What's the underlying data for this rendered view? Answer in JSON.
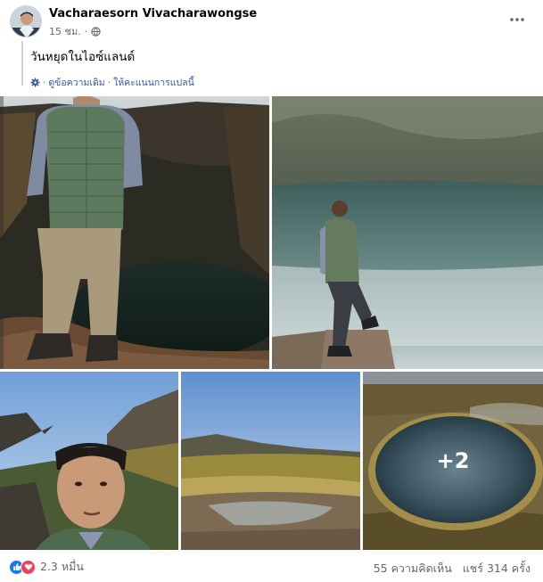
{
  "post": {
    "author": "Vacharaesorn Vivacharawongse",
    "time": "15 ชม.",
    "privacy_icon": "globe-icon",
    "message": "วันหยุดในไอซ์แลนด์",
    "translation": {
      "see_original": "ดูข้อความเดิม",
      "separator": "·",
      "rate_translation": "ให้คะแนนการแปลนี้"
    },
    "photos": {
      "more_count": "+2"
    },
    "reactions": {
      "count": "2.3 หมื่น",
      "icons": [
        "like-icon",
        "love-icon"
      ]
    },
    "comments": "55 ความคิดเห็น",
    "shares": "แชร์ 314 ครั้ง"
  },
  "colors": {
    "link": "#385898",
    "meta": "#65676b",
    "like": "#1877f2",
    "love": "#f33e58"
  }
}
